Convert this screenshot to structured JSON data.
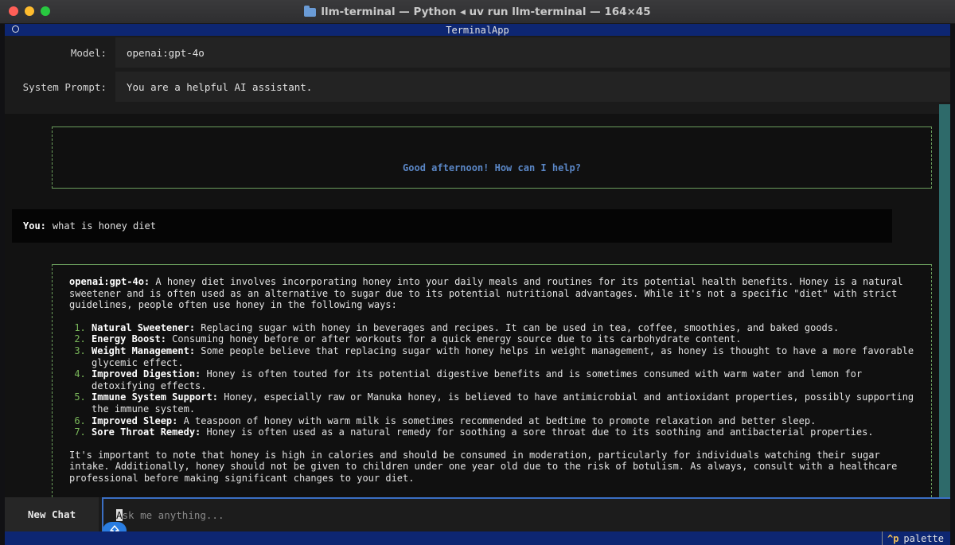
{
  "window": {
    "title": "llm-terminal — Python ◂ uv run llm-terminal — 164×45"
  },
  "app": {
    "header_title": "TerminalApp"
  },
  "settings": {
    "model_label": "Model:",
    "model_value": "openai:gpt-4o",
    "system_prompt_label": "System Prompt:",
    "system_prompt_value": "You are a helpful AI assistant."
  },
  "chat": {
    "greeting": "Good afternoon! How can I help?",
    "user_label": "You:",
    "user_message": "what is honey diet",
    "assistant_label": "openai:gpt-4o:",
    "assistant_intro": "A honey diet involves incorporating honey into your daily meals and routines for its potential health benefits. Honey is a natural sweetener and is often used as an alternative to sugar due to its potential nutritional advantages. While it's not a specific \"diet\" with strict guidelines, people often use honey in the following ways:",
    "items": [
      {
        "title": "Natural Sweetener:",
        "text": "Replacing sugar with honey in beverages and recipes. It can be used in tea, coffee, smoothies, and baked goods."
      },
      {
        "title": "Energy Boost:",
        "text": "Consuming honey before or after workouts for a quick energy source due to its carbohydrate content."
      },
      {
        "title": "Weight Management:",
        "text": "Some people believe that replacing sugar with honey helps in weight management, as honey is thought to have a more favorable glycemic effect."
      },
      {
        "title": "Improved Digestion:",
        "text": "Honey is often touted for its potential digestive benefits and is sometimes consumed with warm water and lemon for detoxifying effects."
      },
      {
        "title": "Immune System Support:",
        "text": "Honey, especially raw or Manuka honey, is believed to have antimicrobial and antioxidant properties, possibly supporting the immune system."
      },
      {
        "title": "Improved Sleep:",
        "text": "A teaspoon of honey with warm milk is sometimes recommended at bedtime to promote relaxation and better sleep."
      },
      {
        "title": "Sore Throat Remedy:",
        "text": "Honey is often used as a natural remedy for soothing a sore throat due to its soothing and antibacterial properties."
      }
    ],
    "assistant_outro": "It's important to note that honey is high in calories and should be consumed in moderation, particularly for individuals watching their sugar intake. Additionally, honey should not be given to children under one year old due to the risk of botulism. As always, consult with a healthcare professional before making significant changes to your diet."
  },
  "input": {
    "new_chat_label": "New Chat",
    "cursor_char": "A",
    "placeholder_rest": "sk me anything..."
  },
  "footer": {
    "palette_key": "^p",
    "palette_label": "palette"
  },
  "colors": {
    "header_bg": "#0d2672",
    "border_green": "#6a9d5c",
    "greeting_blue": "#5a86c5",
    "list_number_green": "#7ab85a",
    "input_focus_blue": "#3b6fc4"
  }
}
